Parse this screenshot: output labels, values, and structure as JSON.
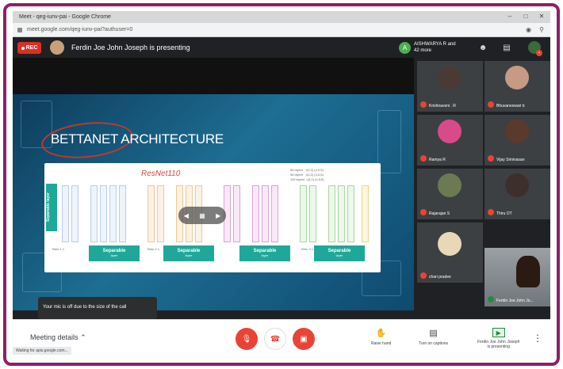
{
  "browser": {
    "title": "Meet - qeg-iunv-pai - Google Chrome",
    "url": "meet.google.com/qeg-iunv-pai?authuser=0"
  },
  "header": {
    "rec_label": "REC",
    "presenting_text": "Ferdin Joe John Joseph is presenting",
    "others_initial": "A",
    "others_text": "AISHWARYA R and 42 more"
  },
  "slide": {
    "title": "BETTANET ARCHITECTURE",
    "handwritten": "ResNet110",
    "notes": "56 layers   r(3,2) (4,5,5)\n98 layers   r(3,2) (4,5,5)\n110 layers  r(3,2) (4,5,5)",
    "separable_left": "Separable layer",
    "separable_box": "Separable",
    "separable_sub": "layer",
    "tags": [
      "Relu 1-1",
      "Relu 2-1",
      "Relu 3-1"
    ]
  },
  "toast": "Your mic is off due to the size of the call",
  "participants": [
    {
      "name": "Krishnaveni . R"
    },
    {
      "name": "Bhuvaneswari b"
    },
    {
      "name": "Ramya R"
    },
    {
      "name": "Vijay Srinivasan"
    },
    {
      "name": "Rajarajan S"
    },
    {
      "name": "Thiru OT"
    },
    {
      "name": "chari pradee"
    },
    {
      "name": "Ferdin Joe John Jo..."
    }
  ],
  "toolbar": {
    "meeting_details": "Meeting details",
    "raise_hand": "Raise hand",
    "captions": "Turn on captions",
    "presenting_line1": "Ferdin Joe John Joseph",
    "presenting_line2": "is presenting"
  },
  "statusbar": "Waiting for apis.google.com...",
  "colors": {
    "frame": "#8e1f66",
    "rec": "#d93025",
    "danger": "#ea4335",
    "teal": "#1fa89a"
  }
}
